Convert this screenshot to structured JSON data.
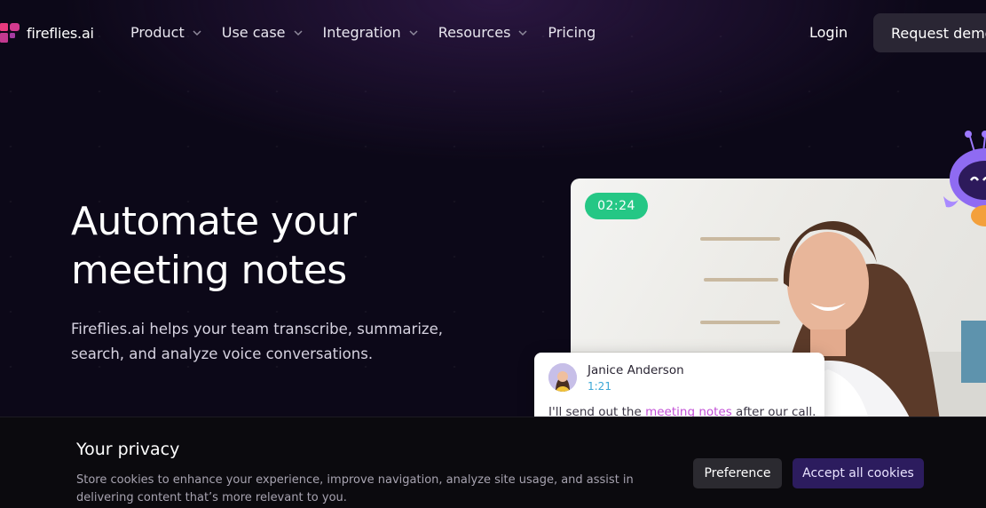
{
  "brand": {
    "name": "fireflies.ai"
  },
  "nav": {
    "items": [
      {
        "label": "Product",
        "has_dropdown": true
      },
      {
        "label": "Use case",
        "has_dropdown": true
      },
      {
        "label": "Integration",
        "has_dropdown": true
      },
      {
        "label": "Resources",
        "has_dropdown": true
      },
      {
        "label": "Pricing",
        "has_dropdown": false
      }
    ],
    "login_label": "Login",
    "demo_label": "Request demo"
  },
  "hero": {
    "title": "Automate your meeting notes",
    "subtitle": "Fireflies.ai helps your team transcribe, summarize, search, and analyze voice conversations."
  },
  "video": {
    "timer": "02:24",
    "comment": {
      "name": "Janice Anderson",
      "time": "1:21",
      "text_before": "I'll send out the ",
      "highlight": "meeting notes",
      "text_after": " after our call."
    }
  },
  "cookie": {
    "title": "Your privacy",
    "text": "Store cookies to enhance your experience, improve navigation, analyze site usage, and assist in delivering content that’s more relevant to you.",
    "preference_label": "Preference",
    "accept_label": "Accept all cookies"
  },
  "colors": {
    "background": "#0c0818",
    "timer_green": "#25c785",
    "highlight_pink": "#c24fd6",
    "time_blue": "#3aa7d6",
    "accept_bg": "#2c1c5e"
  }
}
